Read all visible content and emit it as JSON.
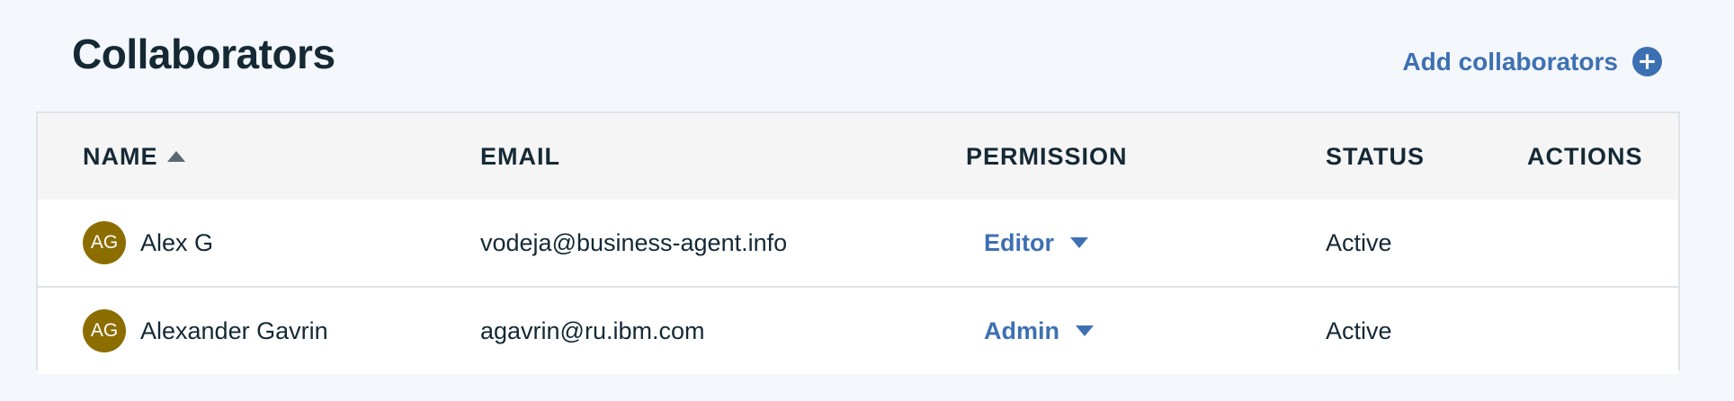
{
  "header": {
    "title": "Collaborators",
    "add_label": "Add collaborators",
    "add_icon": "plus-circle-icon"
  },
  "colors": {
    "accent": "#3d70b2",
    "text": "#152935",
    "avatar_bg": "#8c6d00",
    "header_bg": "#f5f5f5",
    "page_bg": "#f4f7fb"
  },
  "table": {
    "columns": {
      "name": "NAME",
      "email": "EMAIL",
      "permission": "PERMISSION",
      "status": "STATUS",
      "actions": "ACTIONS"
    },
    "sort": {
      "column": "name",
      "direction": "ascending"
    },
    "rows": [
      {
        "initials": "AG",
        "name": "Alex G",
        "email": "vodeja@business-agent.info",
        "permission": "Editor",
        "status": "Active"
      },
      {
        "initials": "AG",
        "name": "Alexander Gavrin",
        "email": "agavrin@ru.ibm.com",
        "permission": "Admin",
        "status": "Active"
      }
    ]
  }
}
